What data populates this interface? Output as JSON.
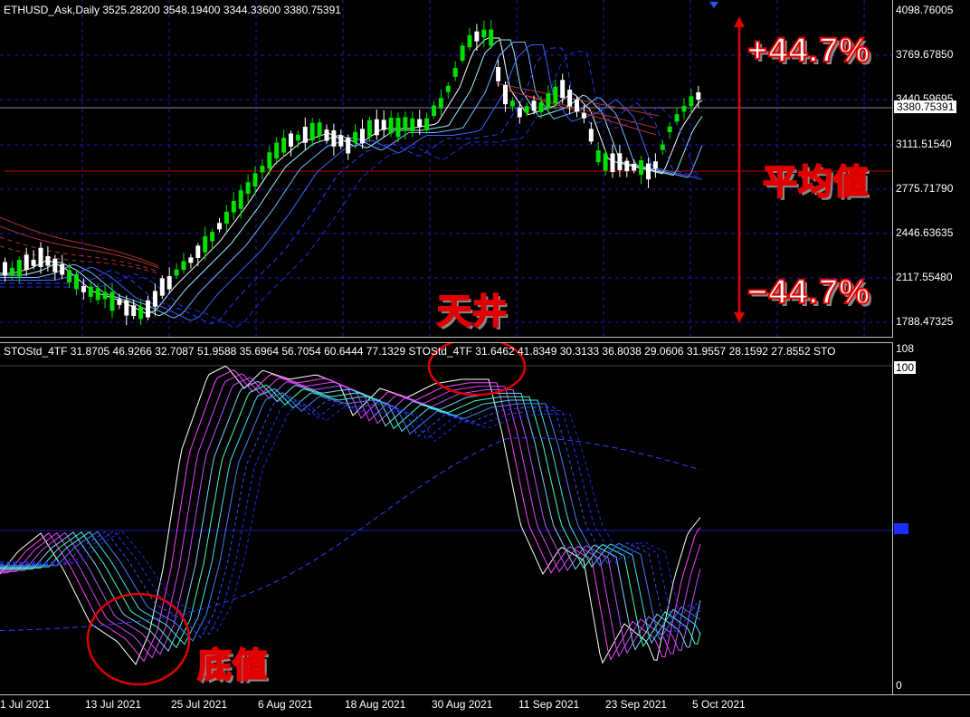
{
  "price_header": "ETHUSD_Ask,Daily  3525.28200 3548.19400 3344.33600 3380.75391",
  "osc_header": "STOStd_4TF 31.8705 46.9266 32.7087 51.9588 35.6964 56.7054 60.6444 77.1329  STOStd_4TF 31.6462 41.8349 30.3133 36.8038 29.0606 31.9557 28.1592 27.8552  STO",
  "price_axis": [
    "4098.76005",
    "3769.67850",
    "3440.59695",
    "3111.51540",
    "2775.71790",
    "2446.63635",
    "2117.55480",
    "1788.47325"
  ],
  "current_price": "3380.75391",
  "osc_axis": {
    "top": "108",
    "hundred": "100",
    "zero": "0"
  },
  "time_axis": [
    "1 Jul 2021",
    "13 Jul 2021",
    "25 Jul 2021",
    "6 Aug 2021",
    "18 Aug 2021",
    "30 Aug 2021",
    "11 Sep 2021",
    "23 Sep 2021",
    "5 Oct 2021"
  ],
  "annotations": {
    "plus": "+44.7%",
    "minus": "−44.7%",
    "mean": "平均値",
    "top": "天井",
    "bottom": "底値"
  },
  "colors": {
    "bull": "#00e000",
    "bear": "#ffffff",
    "grid": "#1a1ab4",
    "mean_line": "#c00000",
    "marker": "#e00000"
  }
}
